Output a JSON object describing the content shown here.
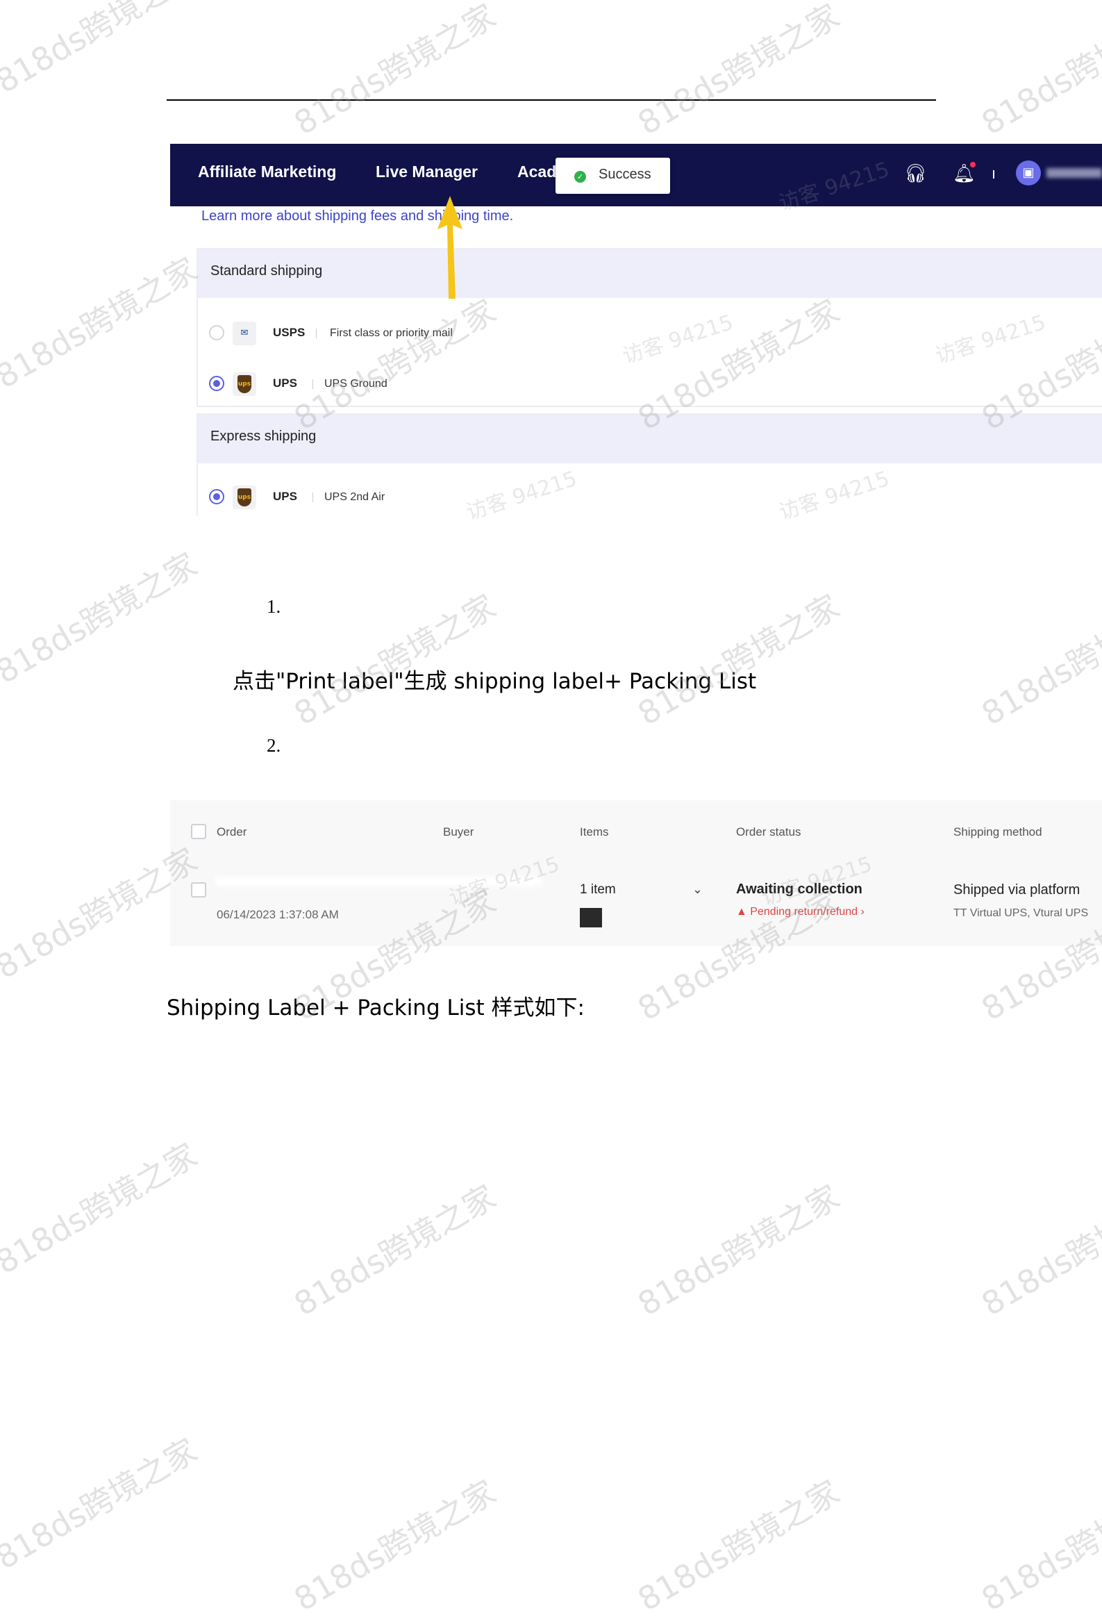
{
  "watermark": {
    "text": "818ds跨境之家",
    "visitor": "访客 94215"
  },
  "shipping_screen": {
    "nav": [
      "Affiliate Marketing",
      "Live Manager",
      "Acad"
    ],
    "toast": "Success",
    "learn_link": "Learn more about shipping fees and shipping time.",
    "standard": {
      "title": "Standard shipping",
      "options": [
        {
          "carrier": "USPS",
          "logo": "usps-logo",
          "service": "First class or priority mail",
          "selected": false
        },
        {
          "carrier": "UPS",
          "logo": "ups-logo",
          "service": "UPS Ground",
          "selected": true
        }
      ]
    },
    "express": {
      "title": "Express shipping",
      "options": [
        {
          "carrier": "UPS",
          "logo": "ups-logo",
          "service": "UPS 2nd Air",
          "selected": true
        }
      ]
    },
    "colors": {
      "navbar": "#11124a",
      "accent": "#5b5fe0",
      "arrow": "#f5c518",
      "success": "#2fb24c"
    }
  },
  "doc": {
    "step1": "1.",
    "step1_text": "点击\"Print label\"生成 shipping label+ Packing List",
    "step2": "2.",
    "style_text": "Shipping Label + Packing List 样式如下:"
  },
  "order_screen": {
    "headers": [
      "Order",
      "Buyer",
      "Items",
      "Order status",
      "Shipping method"
    ],
    "row": {
      "date": "06/14/2023 1:37:08 AM",
      "items": "1 item",
      "status": "Awaiting collection",
      "status_note": "Pending return/refund ›",
      "shipping": "Shipped via platform",
      "shipping_sub": "TT Virtual UPS, Vtural UPS"
    }
  }
}
